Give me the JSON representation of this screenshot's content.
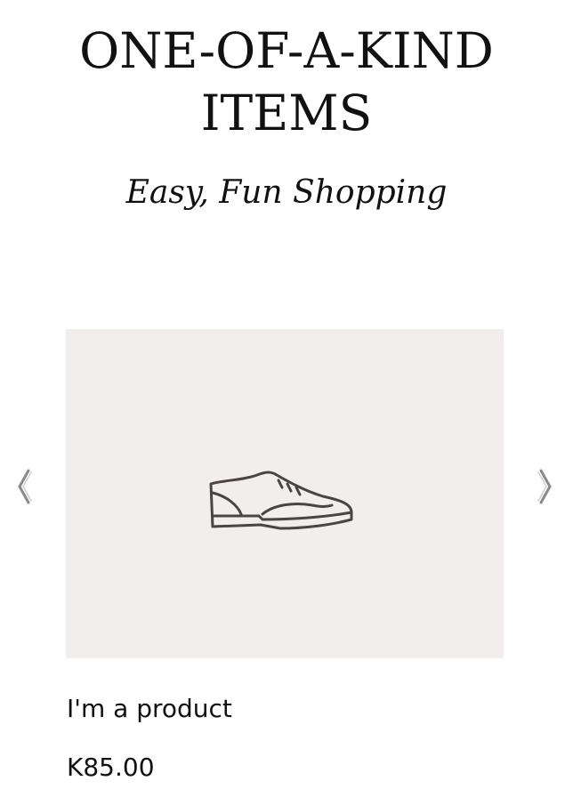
{
  "hero": {
    "title_line1": "ONE-OF-A-KIND",
    "title_line2": "ITEMS",
    "subtitle": "Easy, Fun Shopping"
  },
  "gallery": {
    "prev_icon": "chevron-left-icon",
    "next_icon": "chevron-right-icon",
    "image_icon": "shoe-icon",
    "image_background": "#f2eeed"
  },
  "product": {
    "name": "I'm a product",
    "price": "K85.00"
  }
}
